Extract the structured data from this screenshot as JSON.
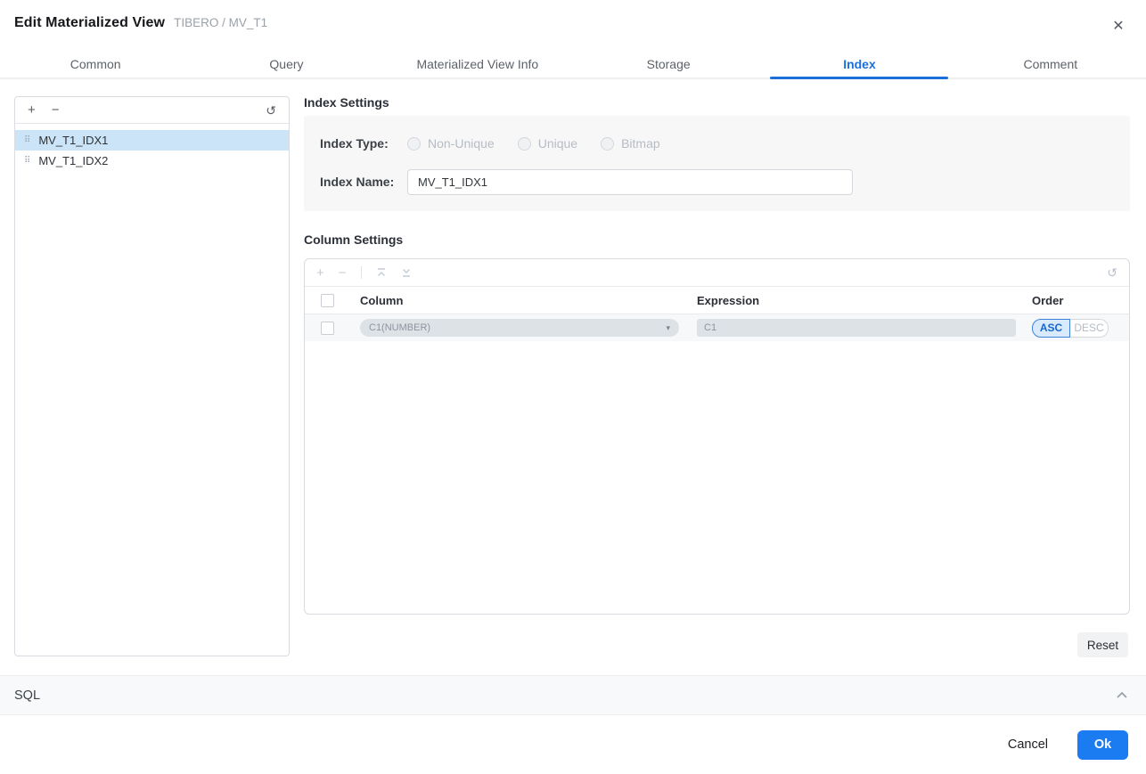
{
  "dialog": {
    "title": "Edit Materialized View",
    "subtitle": "TIBERO / MV_T1"
  },
  "tabs": [
    {
      "label": "Common",
      "active": false
    },
    {
      "label": "Query",
      "active": false
    },
    {
      "label": "Materialized View Info",
      "active": false
    },
    {
      "label": "Storage",
      "active": false
    },
    {
      "label": "Index",
      "active": true
    },
    {
      "label": "Comment",
      "active": false
    }
  ],
  "index_list": {
    "items": [
      {
        "name": "MV_T1_IDX1",
        "selected": true
      },
      {
        "name": "MV_T1_IDX2",
        "selected": false
      }
    ]
  },
  "index_settings": {
    "section_title": "Index Settings",
    "index_type_label": "Index Type:",
    "index_type_options": [
      "Non-Unique",
      "Unique",
      "Bitmap"
    ],
    "index_name_label": "Index Name:",
    "index_name_value": "MV_T1_IDX1"
  },
  "column_settings": {
    "section_title": "Column Settings",
    "headers": {
      "column": "Column",
      "expression": "Expression",
      "order": "Order"
    },
    "rows": [
      {
        "column": "C1(NUMBER)",
        "expression": "C1",
        "order": "ASC",
        "order_options": [
          "ASC",
          "DESC"
        ]
      }
    ]
  },
  "buttons": {
    "reset": "Reset",
    "cancel": "Cancel",
    "ok": "Ok"
  },
  "sql_section": {
    "label": "SQL"
  },
  "icons": {
    "close": "✕",
    "add": "+",
    "remove": "−",
    "refresh": "↺",
    "drag_handle": "⠿",
    "dropdown_caret": "▾"
  },
  "colors": {
    "accent_blue": "#1b7cf2",
    "active_tab_blue": "#1b6fd8",
    "selected_item_bg": "#cbe4f7",
    "asc_bg": "#d8eafc",
    "asc_border": "#3d83dc",
    "disabled_field_bg": "#dde2e7",
    "panel_bg": "#f7f7f8"
  }
}
